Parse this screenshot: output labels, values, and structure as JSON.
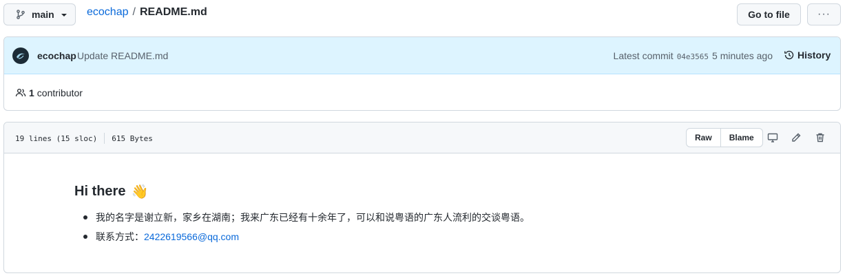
{
  "top": {
    "branch_label": "main",
    "repo": "ecochap",
    "separator": "/",
    "file_name": "README.md",
    "goto_label": "Go to file",
    "more_label": "···"
  },
  "commit": {
    "author": "ecochap",
    "message": "Update README.md",
    "latest_label": "Latest commit",
    "sha": "04e3565",
    "time_ago": "5 minutes ago",
    "history_label": "History",
    "contributor_count": "1",
    "contributor_label": "contributor"
  },
  "file": {
    "lines_info": "19 lines (15 sloc)",
    "size_info": "615 Bytes",
    "raw_label": "Raw",
    "blame_label": "Blame",
    "icons": [
      "desktop-icon",
      "pencil-icon",
      "trash-icon"
    ]
  },
  "readme": {
    "heading": "Hi there",
    "heading_emoji": "👋",
    "items": [
      {
        "text": "我的名字是谢立新，家乡在湖南；我来广东已经有十余年了，可以和说粤语的广东人流利的交谈粤语。"
      },
      {
        "prefix": "联系方式：",
        "link": "2422619566@qq.com"
      }
    ]
  },
  "colors": {
    "accent": "#0969da",
    "commit_bg": "#ddf4ff",
    "border": "#d0d7de",
    "header_bg": "#f6f8fa"
  }
}
